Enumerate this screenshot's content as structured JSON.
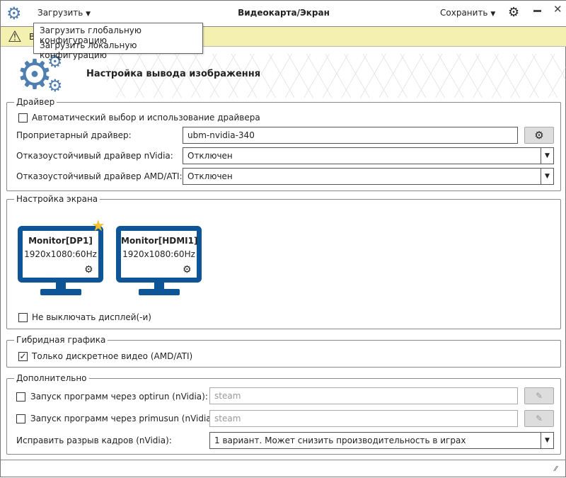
{
  "titlebar": {
    "title": "Видеокарта/Экран",
    "load": "Загрузить",
    "save": "Сохранить",
    "load_menu": [
      "Загрузить глобальную конфигурацию",
      "Загрузить локальную конфигурацию"
    ]
  },
  "warning": {
    "text": "В"
  },
  "header": {
    "title": "Настройка вывода изображення"
  },
  "driver": {
    "title": "Драйвер",
    "auto_label": "Автоматический выбор и использование драйвера",
    "auto_checked": false,
    "proprietary_label": "Проприетарный драйвер:",
    "proprietary_value": "ubm-nvidia-340",
    "nvidia_fallback_label": "Отказоустойчивый драйвер nVidia:",
    "nvidia_fallback_value": "Отключен",
    "amd_fallback_label": "Отказоустойчивый драйвер AMD/ATI:",
    "amd_fallback_value": "Отключен"
  },
  "screen": {
    "title": "Настройка экрана",
    "monitors": [
      {
        "name": "Monitor[DP1]",
        "mode": "1920x1080:60Hz",
        "primary": true
      },
      {
        "name": "Monitor[HDMI1]",
        "mode": "1920x1080:60Hz",
        "primary": false
      }
    ],
    "keep_on_label": "Не выключать дисплей(-и)",
    "keep_on_checked": false
  },
  "hybrid": {
    "title": "Гибридная графика",
    "discrete_label": "Только дискретное видео (AMD/ATI)",
    "discrete_checked": true
  },
  "extra": {
    "title": "Дополнительно",
    "optirun_label": "Запуск программ через optirun (nVidia):",
    "optirun_placeholder": "steam",
    "primusun_label": "Запуск программ через primusun (nVidia):",
    "primusun_placeholder": "steam",
    "tearing_label": "Исправить разрыв кадров (nVidia):",
    "tearing_value": "1 вариант. Может снизить производительность в играх"
  },
  "colors": {
    "accent": "#0d5596",
    "warning_bg": "#f3f0b0",
    "star": "#f2c230",
    "gear_icon": "#4f7fb0"
  }
}
